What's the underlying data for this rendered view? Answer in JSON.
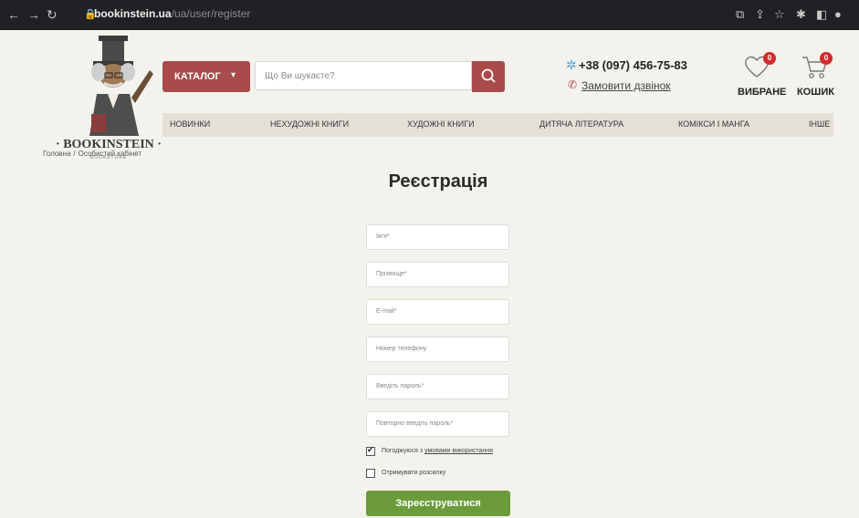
{
  "browser": {
    "host": "bookinstein.ua",
    "path": "/ua/user/register"
  },
  "header": {
    "logo_name": "· BOOKINSTEIN ·",
    "logo_sub": "BOOKSTORE",
    "catalog_label": "КАТАЛОГ",
    "search_placeholder": "Що Ви шукаєте?",
    "phone": "+38 (097) 456-75-83",
    "callback_label": "Замовити дзвінок",
    "wishlist_label": "ВИБРАНЕ",
    "wishlist_count": "0",
    "cart_label": "КОШИК",
    "cart_count": "0"
  },
  "menu": [
    {
      "label": "НОВИНКИ"
    },
    {
      "label": "НЕХУДОЖНІ КНИГИ"
    },
    {
      "label": "ХУДОЖНІ КНИГИ"
    },
    {
      "label": "ДИТЯЧА ЛІТЕРАТУРА"
    },
    {
      "label": "КОМІКСИ І МАНГА"
    },
    {
      "label": "ІНШЕ"
    }
  ],
  "breadcrumb": {
    "home": "Головна",
    "separator": "/",
    "current": "Особистий кабінет"
  },
  "form": {
    "title": "Реєстрація",
    "fields": [
      {
        "placeholder": "Ім'я*"
      },
      {
        "placeholder": "Прізвище*"
      },
      {
        "placeholder": "E-mail*"
      },
      {
        "placeholder": "Номер телефону"
      },
      {
        "placeholder": "Введіть пароль*"
      },
      {
        "placeholder": "Повторно введіть пароль*"
      }
    ],
    "agree_prefix": "Погоджуюся з",
    "agree_link": "умовами використання",
    "agree_checked": true,
    "newsletter_label": "Отримувати розсилку",
    "newsletter_checked": false,
    "submit_label": "Зареєструватися"
  },
  "colors": {
    "accent": "#a94b4b",
    "submit": "#6b9b3a",
    "badge": "#d42b2b"
  },
  "icons": {
    "back": "arrow-left",
    "forward": "arrow-right",
    "reload": "reload",
    "search": "search",
    "phone": "phone",
    "wishlist": "heart",
    "cart": "cart"
  }
}
